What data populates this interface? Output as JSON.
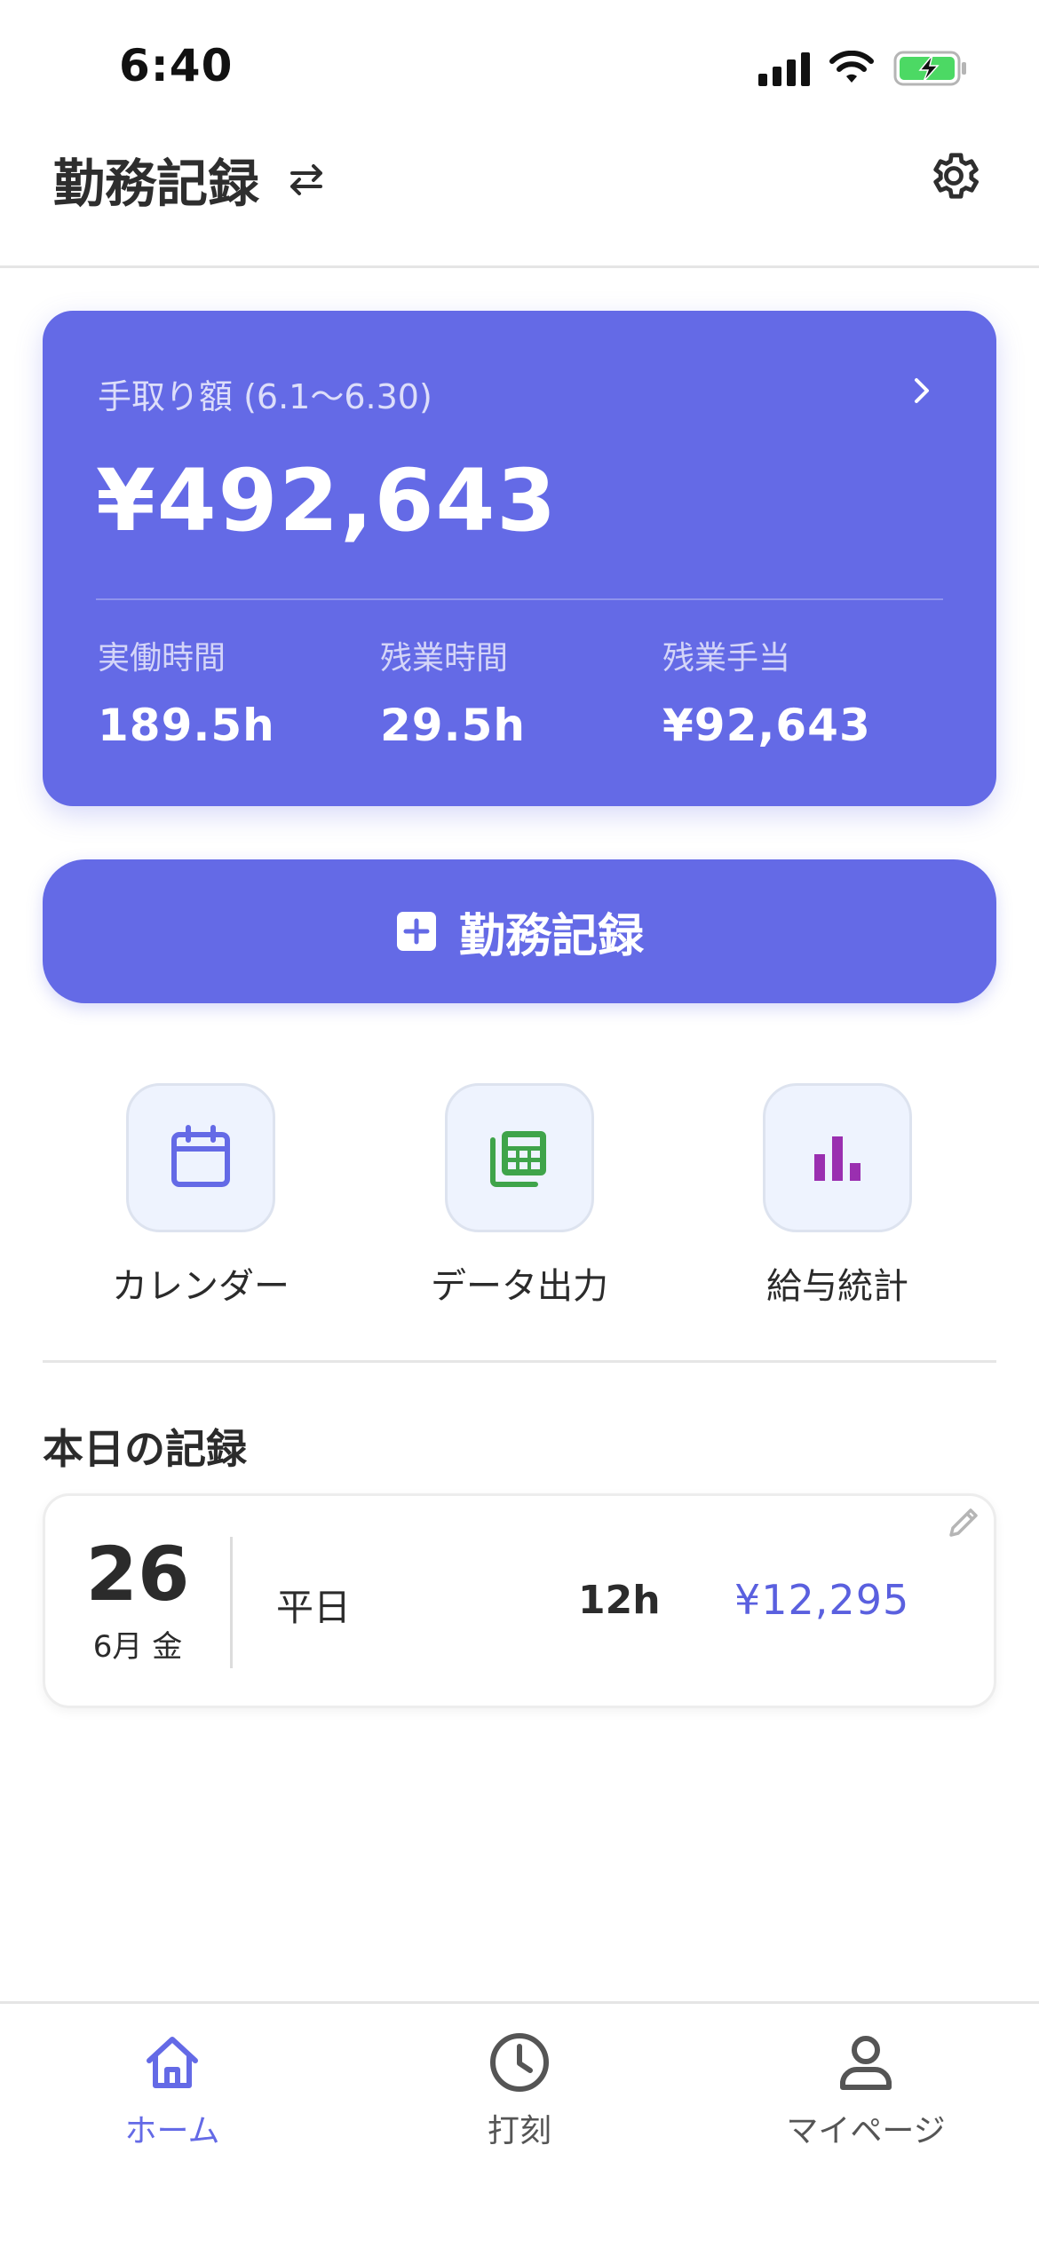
{
  "status_bar": {
    "time": "6:40"
  },
  "header": {
    "title": "勤務記録"
  },
  "summary": {
    "label": "手取り額 (6.1〜6.30)",
    "amount": "¥492,643",
    "stats": [
      {
        "label": "実働時間",
        "value": "189.5h"
      },
      {
        "label": "残業時間",
        "value": "29.5h"
      },
      {
        "label": "残業手当",
        "value": "¥92,643"
      }
    ]
  },
  "record_button": {
    "label": "勤務記録"
  },
  "quick_actions": [
    {
      "label": "カレンダー",
      "icon": "calendar-icon",
      "color": "#646ae6"
    },
    {
      "label": "データ出力",
      "icon": "spreadsheet-icon",
      "color": "#3fa44a"
    },
    {
      "label": "給与統計",
      "icon": "bar-chart-icon",
      "color": "#9a2fb0"
    }
  ],
  "today": {
    "title": "本日の記録",
    "day": "26",
    "month_weekday": "6月 金",
    "type": "平日",
    "hours": "12h",
    "pay": "¥12,295"
  },
  "nav": [
    {
      "label": "ホーム",
      "icon": "home-icon",
      "active": true
    },
    {
      "label": "打刻",
      "icon": "clock-icon",
      "active": false
    },
    {
      "label": "マイページ",
      "icon": "person-icon",
      "active": false
    }
  ],
  "colors": {
    "accent": "#646ae6",
    "pay_text": "#5a60df",
    "inactive": "#555555"
  }
}
